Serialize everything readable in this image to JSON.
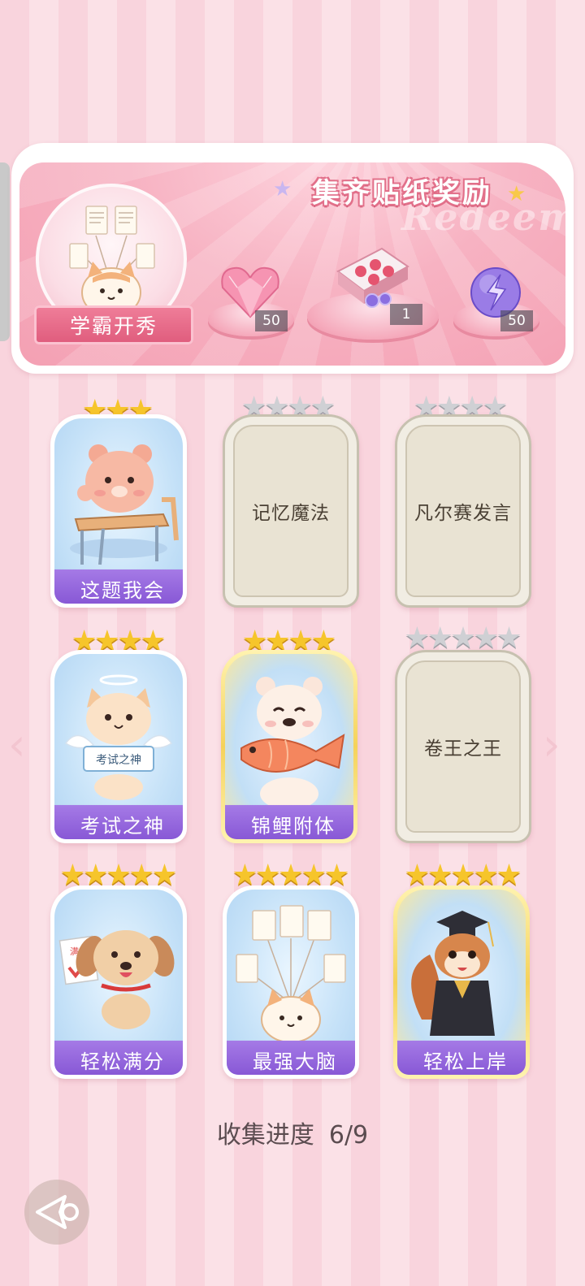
{
  "banner": {
    "title": "集齐贴纸奖励",
    "watermark": "Redeem",
    "feature_label": "学霸开秀",
    "rewards": [
      {
        "icon": "pink-heart-gem-icon",
        "count": "50"
      },
      {
        "icon": "gift-box-icon",
        "count": "1"
      },
      {
        "icon": "purple-energy-orb-icon",
        "count": "50"
      }
    ]
  },
  "stickers": [
    {
      "name": "这题我会",
      "stars": 3,
      "max_stars": 3,
      "unlocked": true,
      "icon": "bear-at-desk-icon"
    },
    {
      "name": "记忆魔法",
      "stars": 0,
      "max_stars": 4,
      "unlocked": false
    },
    {
      "name": "凡尔赛发言",
      "stars": 0,
      "max_stars": 4,
      "unlocked": false
    },
    {
      "name": "考试之神",
      "stars": 4,
      "max_stars": 4,
      "unlocked": true,
      "icon": "angel-cat-icon",
      "sign_text": "考试之神"
    },
    {
      "name": "锦鲤附体",
      "stars": 4,
      "max_stars": 4,
      "unlocked": true,
      "icon": "bear-with-koi-icon",
      "gold": true
    },
    {
      "name": "卷王之王",
      "stars": 0,
      "max_stars": 5,
      "unlocked": false
    },
    {
      "name": "轻松满分",
      "stars": 5,
      "max_stars": 5,
      "unlocked": true,
      "icon": "puppy-full-score-icon",
      "sign_text": "满分"
    },
    {
      "name": "最强大脑",
      "stars": 5,
      "max_stars": 5,
      "unlocked": true,
      "icon": "cat-with-papers-icon"
    },
    {
      "name": "轻松上岸",
      "stars": 5,
      "max_stars": 5,
      "unlocked": true,
      "icon": "graduate-squirrel-icon",
      "gold": true
    }
  ],
  "progress": {
    "label": "收集进度",
    "value": "6/9",
    "fraction": 0.667
  },
  "colors": {
    "label_purple": "#8555d4",
    "banner_pink": "#f4a0b3",
    "star_gold": "#f6c52b",
    "star_grey": "#cfd0d4"
  }
}
